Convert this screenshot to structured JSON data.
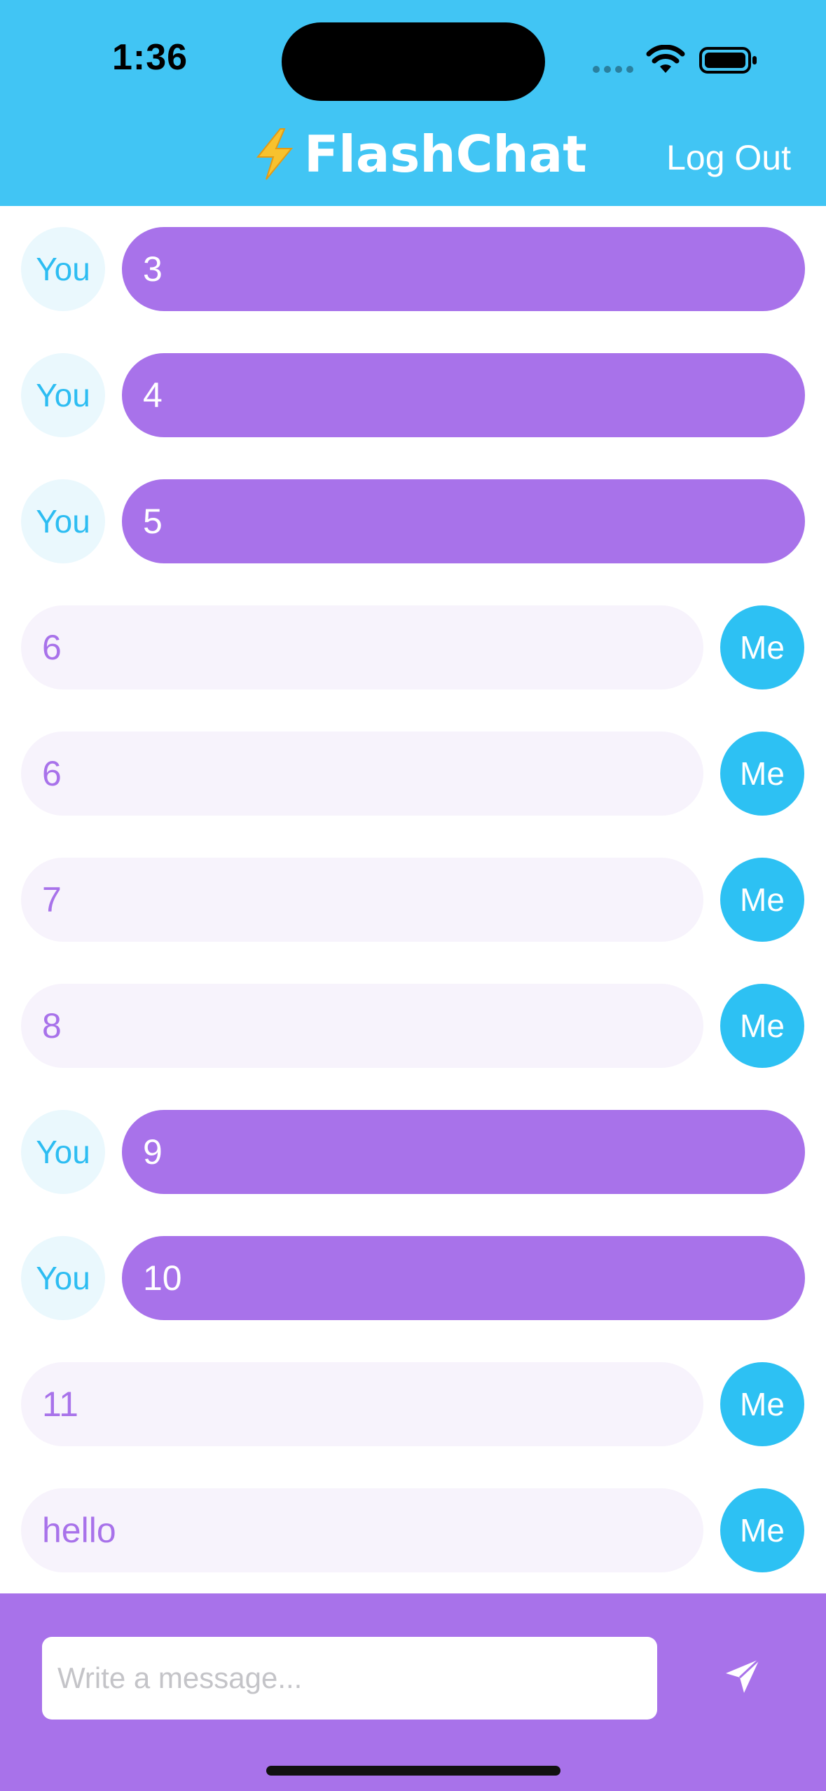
{
  "status_bar": {
    "time": "1:36"
  },
  "header": {
    "title": "FlashChat",
    "logout_label": "Log Out"
  },
  "messages": [
    {
      "sender": "You",
      "text": "3",
      "mine": false
    },
    {
      "sender": "You",
      "text": "4",
      "mine": false
    },
    {
      "sender": "You",
      "text": "5",
      "mine": false
    },
    {
      "sender": "Me",
      "text": "6",
      "mine": true
    },
    {
      "sender": "Me",
      "text": "6",
      "mine": true
    },
    {
      "sender": "Me",
      "text": "7",
      "mine": true
    },
    {
      "sender": "Me",
      "text": "8",
      "mine": true
    },
    {
      "sender": "You",
      "text": "9",
      "mine": false
    },
    {
      "sender": "You",
      "text": "10",
      "mine": false
    },
    {
      "sender": "Me",
      "text": "11",
      "mine": true
    },
    {
      "sender": "Me",
      "text": "hello",
      "mine": true
    }
  ],
  "composer": {
    "value": "",
    "placeholder": "Write a message..."
  },
  "icons": {
    "bolt": "lightning-bolt-icon",
    "send": "paper-plane-icon",
    "wifi": "wifi-icon",
    "battery": "battery-icon"
  },
  "colors": {
    "header_bg": "#41C5F4",
    "accent_purple": "#A872EA",
    "me_avatar": "#2DC1F3",
    "you_avatar_bg": "#EAF8FD",
    "mine_bubble_bg": "#F7F3FC"
  }
}
